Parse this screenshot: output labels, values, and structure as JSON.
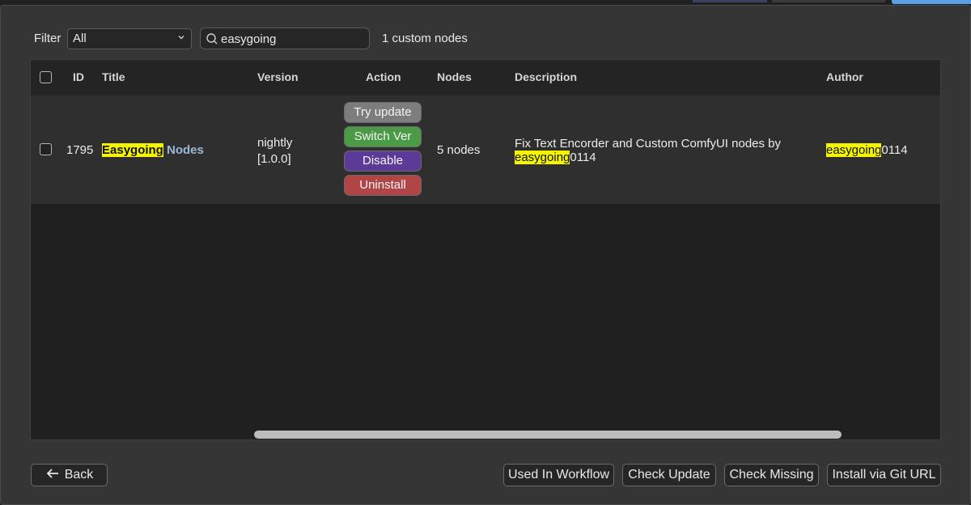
{
  "filter": {
    "label": "Filter",
    "selected": "All",
    "search_value": "easygoing",
    "count_text": "1 custom nodes"
  },
  "table": {
    "columns": [
      "ID",
      "Title",
      "Version",
      "Action",
      "Nodes",
      "Description",
      "Author"
    ],
    "rows": [
      {
        "id": "1795",
        "title_highlight": "Easygoing",
        "title_rest": " Nodes",
        "version_line1": "nightly",
        "version_line2": "[1.0.0]",
        "actions": [
          "Try update",
          "Switch Ver",
          "Disable",
          "Uninstall"
        ],
        "nodes": "5 nodes",
        "description_line1": "Fix Text Encorder and Custom ComfyUI nodes by",
        "description_highlight": "easygoing",
        "description_rest": "0114",
        "author_highlight": "easygoing",
        "author_rest": "0114"
      }
    ]
  },
  "footer": {
    "back": "Back",
    "used_in_workflow": "Used In Workflow",
    "check_update": "Check Update",
    "check_missing": "Check Missing",
    "install_git": "Install via Git URL"
  },
  "colors": {
    "highlight": "#f5f500",
    "try_update": "#7d7d7d",
    "switch_ver": "#4b9a45",
    "disable": "#5b3b97",
    "uninstall": "#b14444"
  },
  "icons": {
    "search": "search-icon",
    "dropdown": "chevron-down-icon",
    "back": "arrow-left-icon"
  }
}
